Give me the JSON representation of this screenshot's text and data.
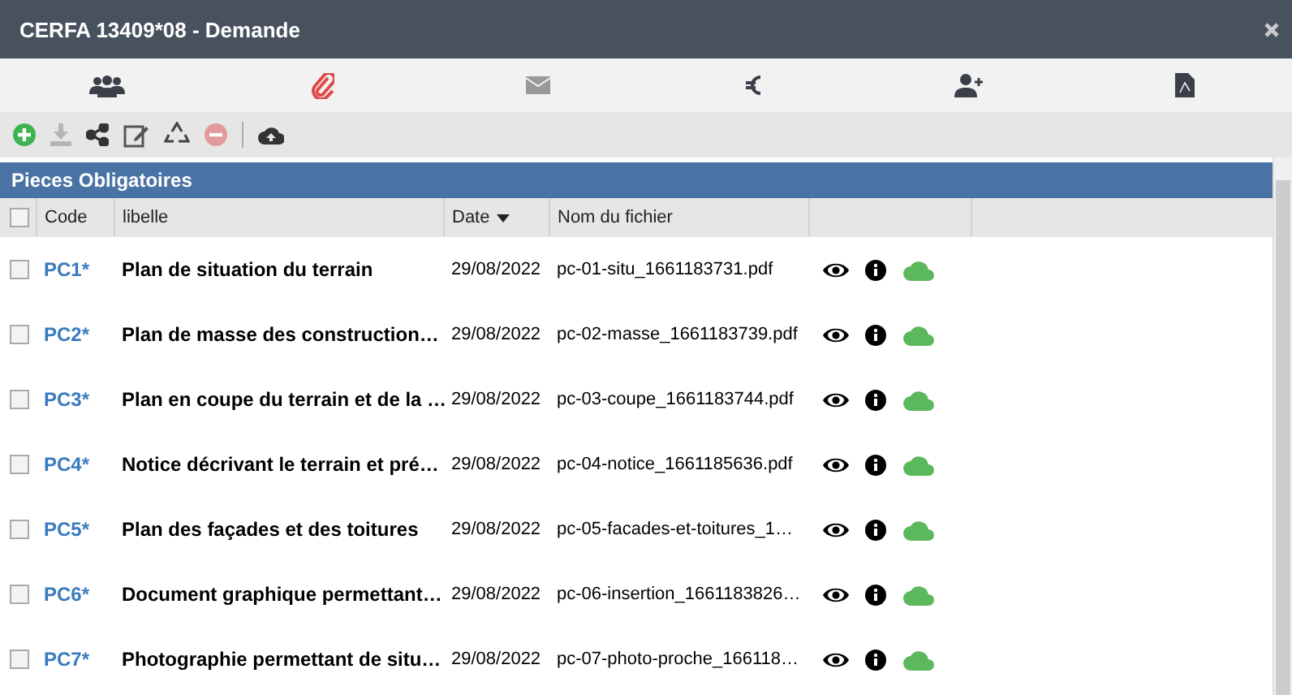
{
  "window": {
    "title": "CERFA 13409*08 - Demande"
  },
  "tabs": [
    {
      "kind": "users",
      "selected": false
    },
    {
      "kind": "paperclip",
      "selected": true
    },
    {
      "kind": "mail",
      "selected": false
    },
    {
      "kind": "euro",
      "selected": false
    },
    {
      "kind": "user-add",
      "selected": false
    },
    {
      "kind": "pdf",
      "selected": false
    }
  ],
  "toolbar": [
    {
      "kind": "add",
      "disabled": false
    },
    {
      "kind": "download",
      "disabled": true
    },
    {
      "kind": "share",
      "disabled": false
    },
    {
      "kind": "edit",
      "disabled": false
    },
    {
      "kind": "recycle",
      "disabled": false
    },
    {
      "kind": "remove",
      "disabled": true
    },
    {
      "kind": "separator",
      "disabled": false
    },
    {
      "kind": "upload",
      "disabled": false
    }
  ],
  "panel": {
    "title": "Pieces Obligatoires",
    "table": {
      "header_checked": false,
      "columns": [
        {
          "label": "Code",
          "sorted": false
        },
        {
          "label": "libelle",
          "sorted": false
        },
        {
          "label": "Date",
          "sorted": true
        },
        {
          "label": "Nom du fichier",
          "sorted": false
        }
      ],
      "rows": [
        {
          "checked": false,
          "code": "PC1*",
          "libelle": "Plan de situation du terrain",
          "date": "29/08/2022",
          "file": "pc-01-situ_1661183731.pdf"
        },
        {
          "checked": false,
          "code": "PC2*",
          "libelle": "Plan de masse des construction…",
          "date": "29/08/2022",
          "file": "pc-02-masse_1661183739.pdf"
        },
        {
          "checked": false,
          "code": "PC3*",
          "libelle": "Plan en coupe du terrain et de la …",
          "date": "29/08/2022",
          "file": "pc-03-coupe_1661183744.pdf"
        },
        {
          "checked": false,
          "code": "PC4*",
          "libelle": "Notice décrivant le terrain et pré…",
          "date": "29/08/2022",
          "file": "pc-04-notice_1661185636.pdf"
        },
        {
          "checked": false,
          "code": "PC5*",
          "libelle": "Plan des façades et des toitures",
          "date": "29/08/2022",
          "file": "pc-05-facades-et-toitures_1…"
        },
        {
          "checked": false,
          "code": "PC6*",
          "libelle": "Document graphique permettant…",
          "date": "29/08/2022",
          "file": "pc-06-insertion_1661183826…"
        },
        {
          "checked": false,
          "code": "PC7*",
          "libelle": "Photographie permettant de situ…",
          "date": "29/08/2022",
          "file": "pc-07-photo-proche_166118…"
        }
      ]
    }
  }
}
